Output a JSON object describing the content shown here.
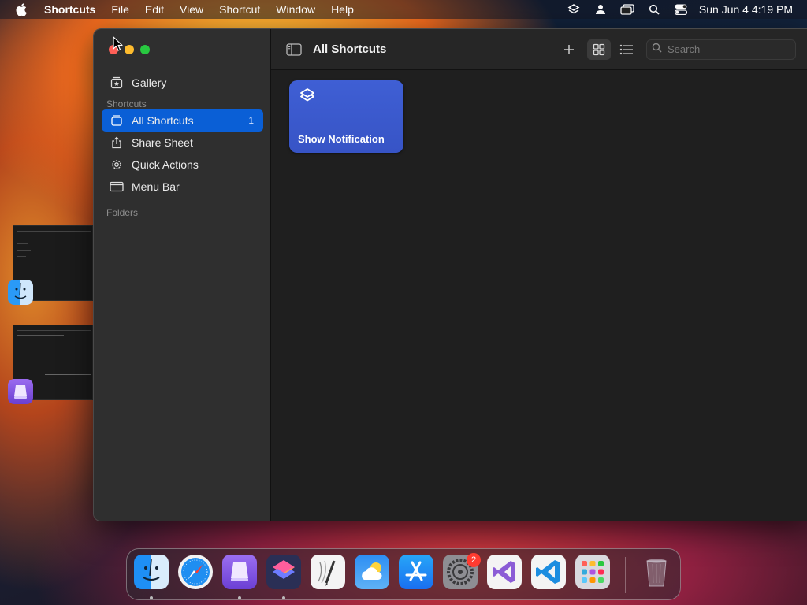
{
  "menubar": {
    "app_name": "Shortcuts",
    "menus": [
      "File",
      "Edit",
      "View",
      "Shortcut",
      "Window",
      "Help"
    ],
    "status_icons": [
      "shortcuts-status-icon",
      "user-icon",
      "screen-mirroring-icon",
      "spotlight-icon",
      "control-center-icon"
    ],
    "clock": "Sun Jun 4  4:19 PM"
  },
  "window": {
    "sidebar": {
      "gallery": "Gallery",
      "section_shortcuts": "Shortcuts",
      "items": [
        {
          "label": "All Shortcuts",
          "count": "1",
          "icon": "stack-icon",
          "active": true
        },
        {
          "label": "Share Sheet",
          "count": "",
          "icon": "share-icon",
          "active": false
        },
        {
          "label": "Quick Actions",
          "count": "",
          "icon": "gear-icon",
          "active": false
        },
        {
          "label": "Menu Bar",
          "count": "",
          "icon": "menubar-icon",
          "active": false
        }
      ],
      "section_folders": "Folders"
    },
    "toolbar": {
      "title": "All Shortcuts",
      "search_placeholder": "Search",
      "search_value": ""
    },
    "shortcuts": [
      {
        "name": "Show Notification",
        "color": "#3b5bd0",
        "icon": "layers-icon"
      }
    ]
  },
  "dock": {
    "apps": [
      "Finder",
      "Safari",
      "Simulator",
      "Shortcuts",
      "Script Editor",
      "Weather",
      "App Store",
      "System Settings",
      "Visual Studio",
      "Visual Studio Code",
      "Launchpad",
      "Trash"
    ],
    "settings_badge": "2"
  },
  "colors": {
    "accent": "#0a5fd6",
    "tile": "#3b5bd0"
  }
}
